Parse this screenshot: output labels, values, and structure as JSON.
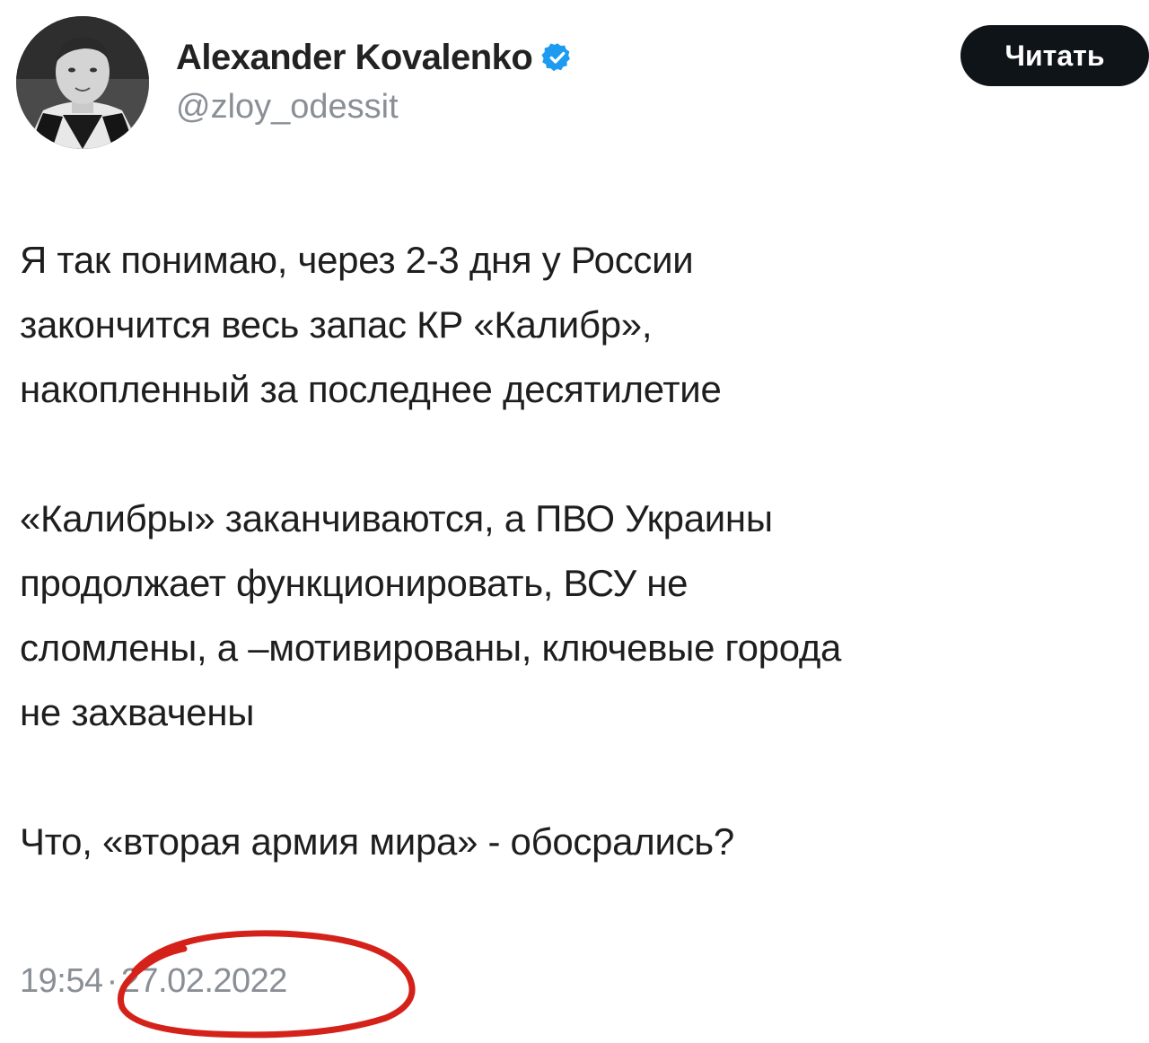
{
  "tweet": {
    "author": {
      "display_name": "Alexander Kovalenko",
      "handle": "@zloy_odessit",
      "avatar_icon": "person-portrait-bw",
      "verified_icon": "verified-badge-icon",
      "verified_color": "#1d9bf0"
    },
    "follow_button_label": "Читать",
    "body": {
      "paragraph_1": [
        "Я так понимаю, через 2-3 дня у России",
        "закончится весь запас КР «Калибр»,",
        "накопленный за последнее десятилетие"
      ],
      "paragraph_2": [
        "«Калибры» заканчиваются, а ПВО Украины",
        "продолжает функционировать, ВСУ не",
        "сломлены, а –мотивированы, ключевые города",
        "не захвачены"
      ],
      "paragraph_3": [
        "Что, «вторая армия мира» - обосрались?"
      ]
    },
    "time": "19:54",
    "separator": "·",
    "date": "27.02.2022"
  },
  "annotation": {
    "type": "hand-drawn circle around date",
    "color": "#d4221a"
  }
}
